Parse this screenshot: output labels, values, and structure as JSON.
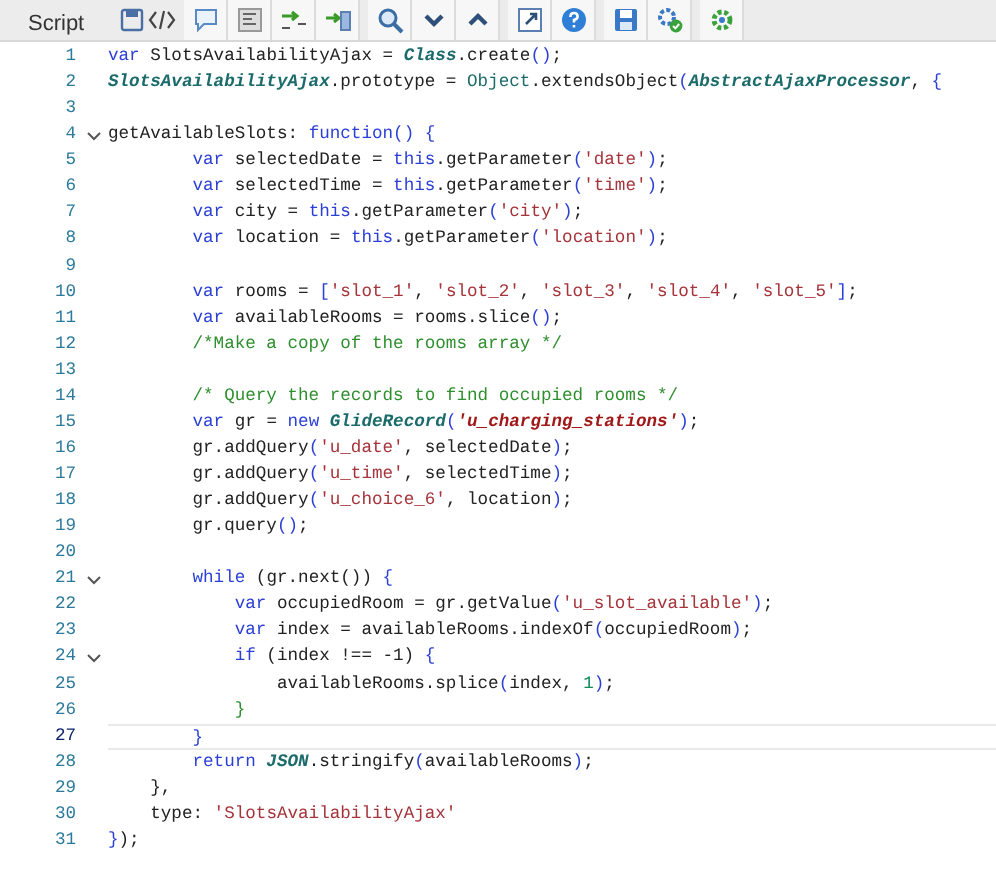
{
  "toolbar": {
    "label": "Script"
  },
  "lines": [
    {
      "number": "1",
      "tokens": [
        {
          "kind": "keyword",
          "text": "var"
        },
        {
          "kind": "plain",
          "text": " SlotsAvailabilityAjax = "
        },
        {
          "kind": "class",
          "text": "Class"
        },
        {
          "kind": "plain",
          "text": ".create"
        },
        {
          "kind": "bracket",
          "text": "()"
        },
        {
          "kind": "plain",
          "text": ";"
        }
      ]
    },
    {
      "number": "2",
      "tokens": [
        {
          "kind": "class",
          "text": "SlotsAvailabilityAjax"
        },
        {
          "kind": "plain",
          "text": ".prototype = "
        },
        {
          "kind": "object",
          "text": "Object"
        },
        {
          "kind": "plain",
          "text": ".extendsObject"
        },
        {
          "kind": "bracket",
          "text": "("
        },
        {
          "kind": "class",
          "text": "AbstractAjaxProcessor"
        },
        {
          "kind": "plain",
          "text": ", "
        },
        {
          "kind": "bracket",
          "text": "{"
        }
      ]
    },
    {
      "number": "3"
    },
    {
      "number": "4",
      "fold": {
        "expanded": true
      },
      "tokens": [
        {
          "kind": "plain",
          "text": "getAvailableSlots: "
        },
        {
          "kind": "keyword",
          "text": "function"
        },
        {
          "kind": "bracket",
          "text": "()"
        },
        {
          "kind": "bracket",
          "text": " {"
        }
      ]
    },
    {
      "number": "5",
      "tokens": [
        {
          "kind": "keyword",
          "text": "        var"
        },
        {
          "kind": "plain",
          "text": " selectedDate = "
        },
        {
          "kind": "keyword",
          "text": "this"
        },
        {
          "kind": "plain",
          "text": ".getParameter"
        },
        {
          "kind": "bracket",
          "text": "("
        },
        {
          "kind": "string",
          "text": "'date'"
        },
        {
          "kind": "bracket",
          "text": ")"
        },
        {
          "kind": "plain",
          "text": ";"
        }
      ]
    },
    {
      "number": "6",
      "tokens": [
        {
          "kind": "keyword",
          "text": "        var"
        },
        {
          "kind": "plain",
          "text": " selectedTime = "
        },
        {
          "kind": "keyword",
          "text": "this"
        },
        {
          "kind": "plain",
          "text": ".getParameter"
        },
        {
          "kind": "bracket",
          "text": "("
        },
        {
          "kind": "string",
          "text": "'time'"
        },
        {
          "kind": "bracket",
          "text": ")"
        },
        {
          "kind": "plain",
          "text": ";"
        }
      ]
    },
    {
      "number": "7",
      "tokens": [
        {
          "kind": "keyword",
          "text": "        var"
        },
        {
          "kind": "plain",
          "text": " city = "
        },
        {
          "kind": "keyword",
          "text": "this"
        },
        {
          "kind": "plain",
          "text": ".getParameter"
        },
        {
          "kind": "bracket",
          "text": "("
        },
        {
          "kind": "string",
          "text": "'city'"
        },
        {
          "kind": "bracket",
          "text": ")"
        },
        {
          "kind": "plain",
          "text": ";"
        }
      ]
    },
    {
      "number": "8",
      "tokens": [
        {
          "kind": "keyword",
          "text": "        var"
        },
        {
          "kind": "plain",
          "text": " location = "
        },
        {
          "kind": "keyword",
          "text": "this"
        },
        {
          "kind": "plain",
          "text": ".getParameter"
        },
        {
          "kind": "bracket",
          "text": "("
        },
        {
          "kind": "string",
          "text": "'location'"
        },
        {
          "kind": "bracket",
          "text": ")"
        },
        {
          "kind": "plain",
          "text": ";"
        }
      ]
    },
    {
      "number": "9"
    },
    {
      "number": "10",
      "tokens": [
        {
          "kind": "keyword",
          "text": "        var"
        },
        {
          "kind": "plain",
          "text": " rooms = "
        },
        {
          "kind": "bracket",
          "text": "["
        },
        {
          "kind": "string",
          "text": "'slot_1'"
        },
        {
          "kind": "plain",
          "text": ", "
        },
        {
          "kind": "string",
          "text": "'slot_2'"
        },
        {
          "kind": "plain",
          "text": ", "
        },
        {
          "kind": "string",
          "text": "'slot_3'"
        },
        {
          "kind": "plain",
          "text": ", "
        },
        {
          "kind": "string",
          "text": "'slot_4'"
        },
        {
          "kind": "plain",
          "text": ", "
        },
        {
          "kind": "string",
          "text": "'slot_5'"
        },
        {
          "kind": "bracket",
          "text": "]"
        },
        {
          "kind": "plain",
          "text": ";"
        }
      ]
    },
    {
      "number": "11",
      "tokens": [
        {
          "kind": "keyword",
          "text": "        var"
        },
        {
          "kind": "plain",
          "text": " availableRooms = rooms.slice"
        },
        {
          "kind": "bracket",
          "text": "()"
        },
        {
          "kind": "plain",
          "text": ";"
        }
      ]
    },
    {
      "number": "12",
      "tokens": [
        {
          "kind": "comment",
          "text": "        /*Make a copy of the rooms array */"
        }
      ]
    },
    {
      "number": "13"
    },
    {
      "number": "14",
      "tokens": [
        {
          "kind": "comment",
          "text": "        /* Query the records to find occupied rooms */"
        }
      ]
    },
    {
      "number": "15",
      "tokens": [
        {
          "kind": "keyword",
          "text": "        var"
        },
        {
          "kind": "plain",
          "text": " gr = "
        },
        {
          "kind": "keyword",
          "text": "new"
        },
        {
          "kind": "class",
          "text": " GlideRecord"
        },
        {
          "kind": "bracket",
          "text": "("
        },
        {
          "kind": "emphasis",
          "text": "'u_charging_stations'"
        },
        {
          "kind": "bracket",
          "text": ")"
        },
        {
          "kind": "plain",
          "text": ";"
        }
      ]
    },
    {
      "number": "16",
      "tokens": [
        {
          "kind": "plain",
          "text": "        gr.addQuery"
        },
        {
          "kind": "bracket",
          "text": "("
        },
        {
          "kind": "string",
          "text": "'u_date'"
        },
        {
          "kind": "plain",
          "text": ", selectedDate"
        },
        {
          "kind": "bracket",
          "text": ")"
        },
        {
          "kind": "plain",
          "text": ";"
        }
      ]
    },
    {
      "number": "17",
      "tokens": [
        {
          "kind": "plain",
          "text": "        gr.addQuery"
        },
        {
          "kind": "bracket",
          "text": "("
        },
        {
          "kind": "string",
          "text": "'u_time'"
        },
        {
          "kind": "plain",
          "text": ", selectedTime"
        },
        {
          "kind": "bracket",
          "text": ")"
        },
        {
          "kind": "plain",
          "text": ";"
        }
      ]
    },
    {
      "number": "18",
      "tokens": [
        {
          "kind": "plain",
          "text": "        gr.addQuery"
        },
        {
          "kind": "bracket",
          "text": "("
        },
        {
          "kind": "string",
          "text": "'u_choice_6'"
        },
        {
          "kind": "plain",
          "text": ", location"
        },
        {
          "kind": "bracket",
          "text": ")"
        },
        {
          "kind": "plain",
          "text": ";"
        }
      ]
    },
    {
      "number": "19",
      "tokens": [
        {
          "kind": "plain",
          "text": "        gr.query"
        },
        {
          "kind": "bracket",
          "text": "()"
        },
        {
          "kind": "plain",
          "text": ";"
        }
      ]
    },
    {
      "number": "20"
    },
    {
      "number": "21",
      "fold": {
        "expanded": true
      },
      "tokens": [
        {
          "kind": "keyword",
          "text": "        while"
        },
        {
          "kind": "plain",
          "text": " (gr.next()) "
        },
        {
          "kind": "bracket",
          "text": "{"
        }
      ]
    },
    {
      "number": "22",
      "tokens": [
        {
          "kind": "keyword",
          "text": "            var"
        },
        {
          "kind": "plain",
          "text": " occupiedRoom = gr.getValue"
        },
        {
          "kind": "bracket",
          "text": "("
        },
        {
          "kind": "string",
          "text": "'u_slot_available'"
        },
        {
          "kind": "bracket",
          "text": ")"
        },
        {
          "kind": "plain",
          "text": ";"
        }
      ]
    },
    {
      "number": "23",
      "tokens": [
        {
          "kind": "keyword",
          "text": "            var"
        },
        {
          "kind": "plain",
          "text": " index = availableRooms.indexOf"
        },
        {
          "kind": "bracket",
          "text": "("
        },
        {
          "kind": "plain",
          "text": "occupiedRoom"
        },
        {
          "kind": "bracket",
          "text": ")"
        },
        {
          "kind": "plain",
          "text": ";"
        }
      ]
    },
    {
      "number": "24",
      "fold": {
        "expanded": true
      },
      "tokens": [
        {
          "kind": "keyword",
          "text": "            if"
        },
        {
          "kind": "plain",
          "text": " (index !== -1) "
        },
        {
          "kind": "bracket",
          "text": "{"
        }
      ]
    },
    {
      "number": "25",
      "tokens": [
        {
          "kind": "plain",
          "text": "                availableRooms.splice"
        },
        {
          "kind": "bracket",
          "text": "("
        },
        {
          "kind": "plain",
          "text": "index, "
        },
        {
          "kind": "number",
          "text": "1"
        },
        {
          "kind": "bracket",
          "text": ")"
        },
        {
          "kind": "plain",
          "text": ";"
        }
      ]
    },
    {
      "number": "26",
      "tokens": [
        {
          "kind": "closer",
          "text": "            }"
        }
      ]
    },
    {
      "number": "27",
      "current": true,
      "tokens": [
        {
          "kind": "bracket",
          "text": "        }"
        }
      ]
    },
    {
      "number": "28",
      "tokens": [
        {
          "kind": "keyword",
          "text": "        return"
        },
        {
          "kind": "class",
          "text": " JSON"
        },
        {
          "kind": "plain",
          "text": ".stringify"
        },
        {
          "kind": "bracket",
          "text": "("
        },
        {
          "kind": "plain",
          "text": "availableRooms"
        },
        {
          "kind": "bracket",
          "text": ")"
        },
        {
          "kind": "plain",
          "text": ";"
        }
      ]
    },
    {
      "number": "29",
      "tokens": [
        {
          "kind": "plain",
          "text": "    },"
        }
      ]
    },
    {
      "number": "30",
      "tokens": [
        {
          "kind": "plain",
          "text": "    type: "
        },
        {
          "kind": "string",
          "text": "'SlotsAvailabilityAjax'"
        }
      ]
    },
    {
      "number": "31",
      "tokens": [
        {
          "kind": "bracket",
          "text": "}"
        },
        {
          "kind": "plain",
          "text": ");"
        }
      ]
    }
  ]
}
